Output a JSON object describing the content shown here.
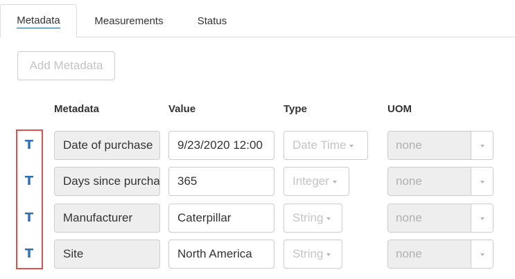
{
  "tabs": [
    {
      "label": "Metadata",
      "active": true
    },
    {
      "label": "Measurements",
      "active": false
    },
    {
      "label": "Status",
      "active": false
    }
  ],
  "add_button": {
    "label": "Add Metadata",
    "enabled": false
  },
  "columns": {
    "metadata": "Metadata",
    "value": "Value",
    "type": "Type",
    "uom": "UOM"
  },
  "rows": [
    {
      "type_icon": "T",
      "metadata": "Date of purchase",
      "value": "9/23/2020 12:00",
      "type": "Date Time",
      "uom": "none"
    },
    {
      "type_icon": "T",
      "metadata": "Days since purchase",
      "value": "365",
      "type": "Integer",
      "uom": "none"
    },
    {
      "type_icon": "T",
      "metadata": "Manufacturer",
      "value": "Caterpillar",
      "type": "String",
      "uom": "none"
    },
    {
      "type_icon": "T",
      "metadata": "Site",
      "value": "North America",
      "type": "String",
      "uom": "none"
    }
  ],
  "colors": {
    "icon": "#2a6fb8",
    "highlight_border": "#d9534f",
    "active_tab_underline": "#1a5f9e",
    "readonly_bg": "#eeeeee",
    "disabled_text": "#c4c4c4"
  }
}
